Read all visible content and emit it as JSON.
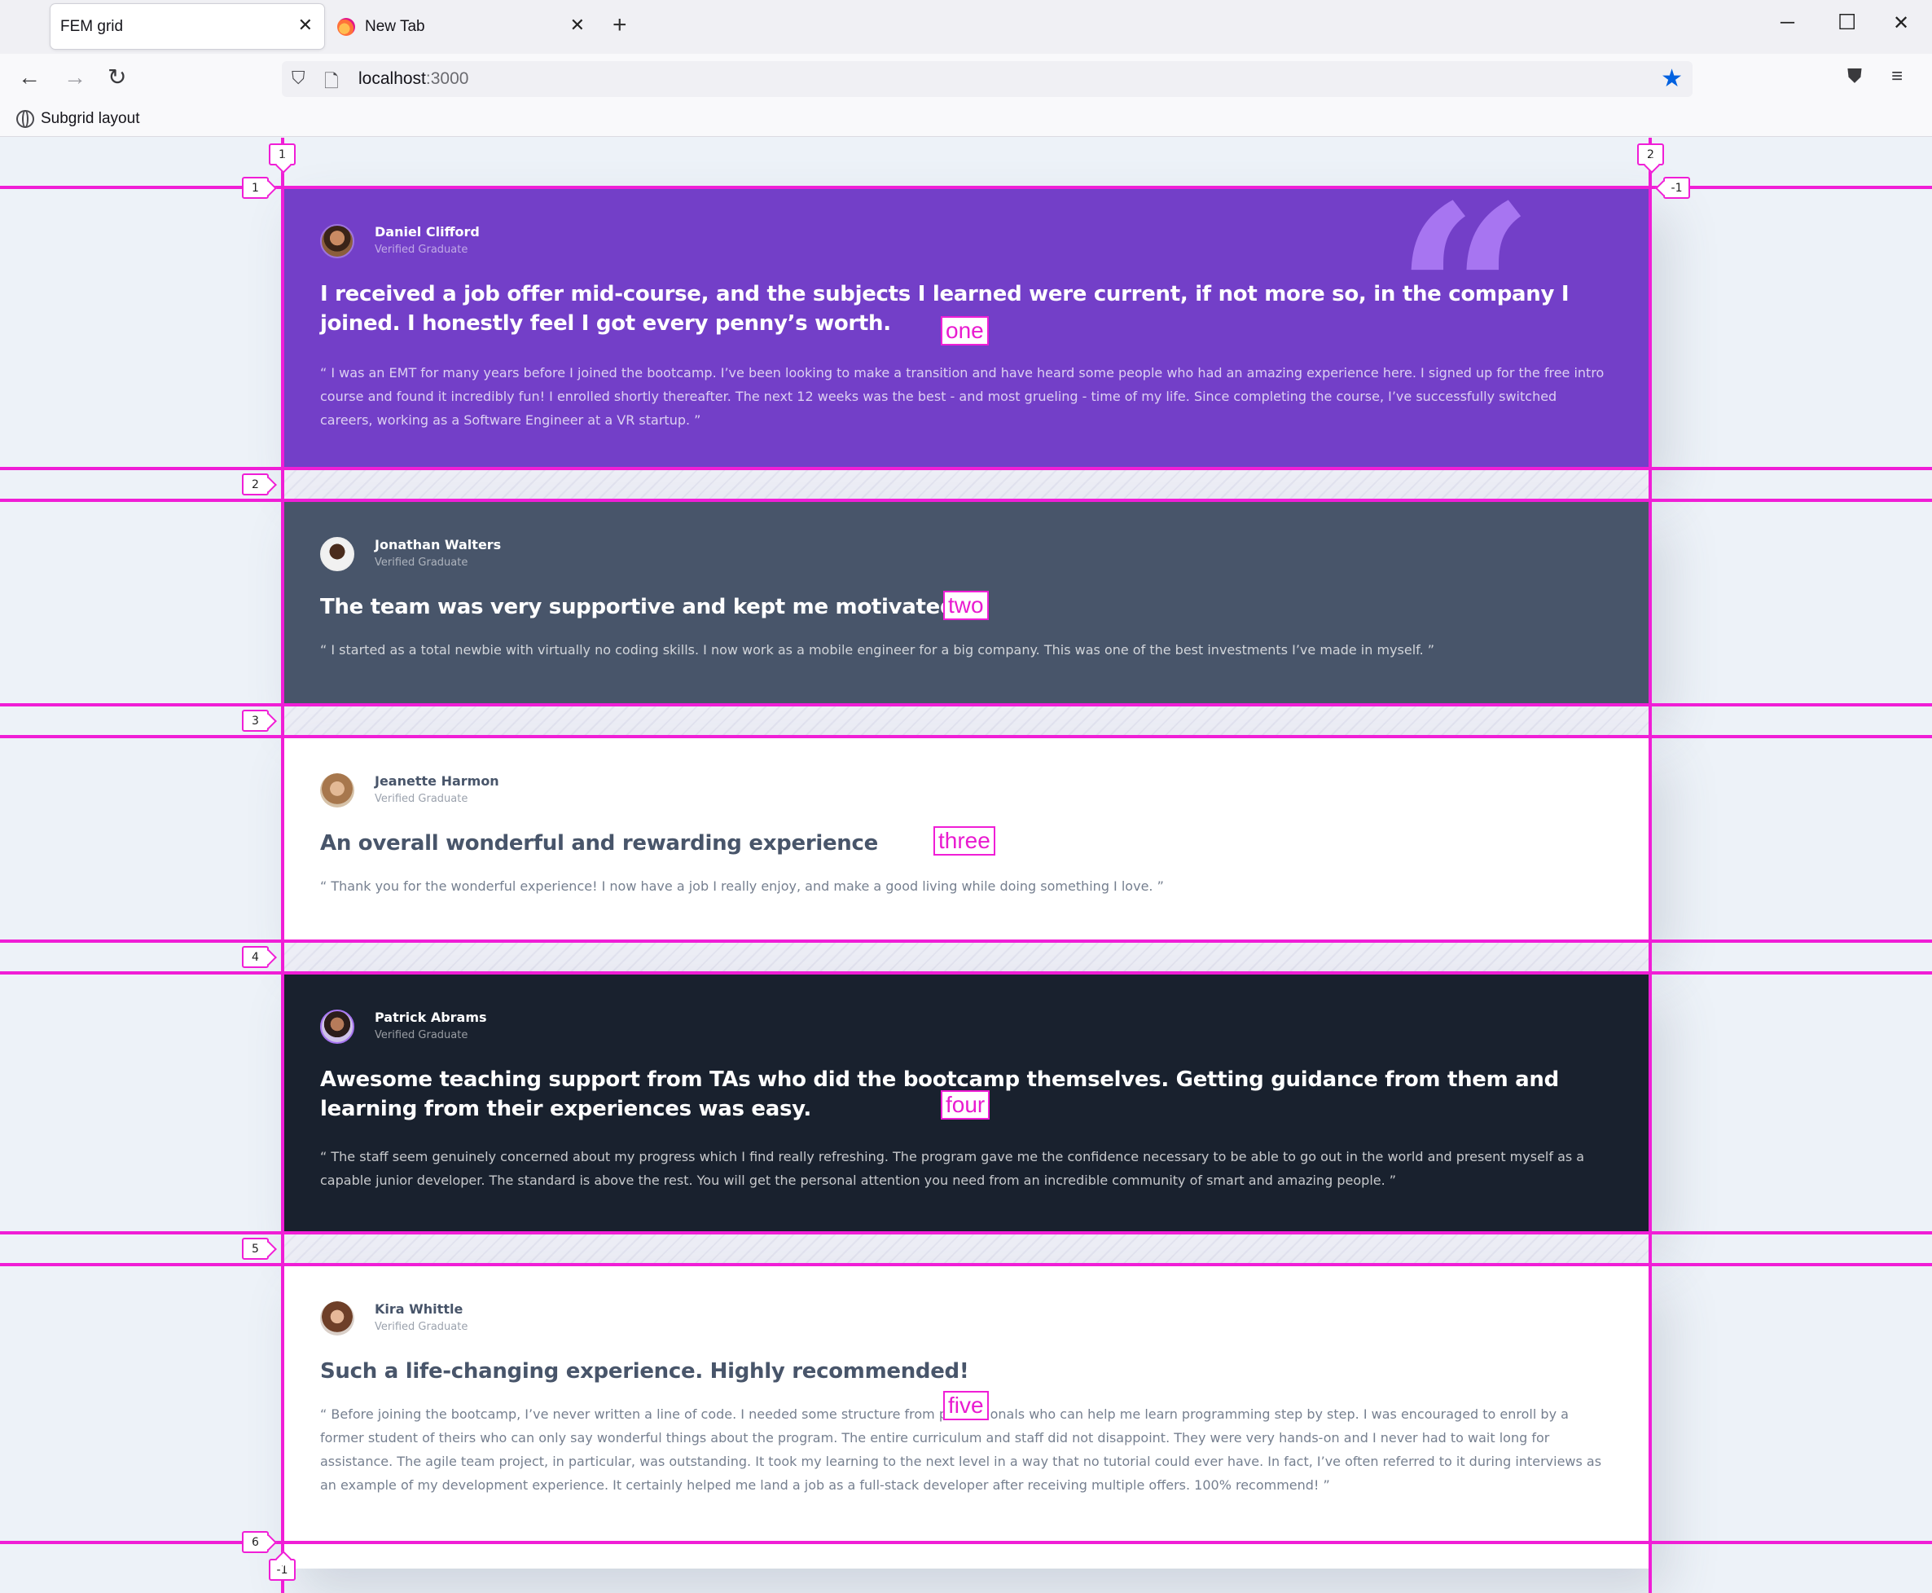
{
  "browser": {
    "tabs": [
      {
        "label": "FEM grid",
        "active": true
      },
      {
        "label": "New Tab",
        "active": false
      }
    ],
    "url_host": "localhost",
    "url_port": ":3000",
    "bookmark": "Subgrid layout"
  },
  "grid_overlay": {
    "row_lines": [
      "1",
      "2",
      "3",
      "4",
      "5",
      "6"
    ],
    "column_lines": [
      "1",
      "2"
    ],
    "negative_start": "-1",
    "negative_end": "-1",
    "color": "#f01ed6"
  },
  "cards": [
    {
      "area": "one",
      "theme": "purple",
      "name": "Daniel Clifford",
      "role": "Verified Graduate",
      "headline": "I received a job offer mid-course, and the subjects I learned were current, if not more so, in the company I joined. I honestly feel I got every penny’s worth.",
      "quote": "“ I was an EMT for many years before I joined the bootcamp. I’ve been looking to make a transition and have heard some people who had an amazing experience here. I signed up for the free intro course and found it incredibly fun! I enrolled shortly thereafter. The next 12 weeks was the best - and most grueling - time of my life. Since completing the course, I’ve successfully switched careers, working as a Software Engineer at a VR startup. ”"
    },
    {
      "area": "two",
      "theme": "slate",
      "name": "Jonathan Walters",
      "role": "Verified Graduate",
      "headline": "The team was very supportive and kept me motivated",
      "quote": "“ I started as a total newbie with virtually no coding skills. I now work as a mobile engineer for a big company. This was one of the best investments I’ve made in myself. ”"
    },
    {
      "area": "three",
      "theme": "white",
      "name": "Jeanette Harmon",
      "role": "Verified Graduate",
      "headline": "An overall wonderful and rewarding experience",
      "quote": "“ Thank you for the wonderful experience! I now have a job I really enjoy, and make a good living while doing something I love. ”"
    },
    {
      "area": "four",
      "theme": "dark",
      "name": "Patrick Abrams",
      "role": "Verified Graduate",
      "headline": "Awesome teaching support from TAs who did the bootcamp themselves. Getting guidance from them and learning from their experiences was easy.",
      "quote": "“ The staff seem genuinely concerned about my progress which I find really refreshing. The program gave me the confidence necessary to be able to go out in the world and present myself as a capable junior developer. The standard is above the rest. You will get the personal attention you need from an incredible community of smart and amazing people. ”"
    },
    {
      "area": "five",
      "theme": "white",
      "name": "Kira Whittle",
      "role": "Verified Graduate",
      "headline": "Such a life-changing experience. Highly recommended!",
      "quote": "“ Before joining the bootcamp, I’ve never written a line of code. I needed some structure from professionals who can help me learn programming step by step. I was encouraged to enroll by a former student of theirs who can only say wonderful things about the program. The entire curriculum and staff did not disappoint. They were very hands-on and I never had to wait long for assistance. The agile team project, in particular, was outstanding. It took my learning to the next level in a way that no tutorial could ever have. In fact, I’ve often referred to it during interviews as an example of my development experience. It certainly helped me land a job as a full-stack developer after receiving multiple offers. 100% recommend! ”"
    }
  ],
  "colors": {
    "purple": "#733fc8",
    "slate": "#48556a",
    "white": "#ffffff",
    "dark": "#19212e",
    "page_bg": "#edf2f8"
  }
}
